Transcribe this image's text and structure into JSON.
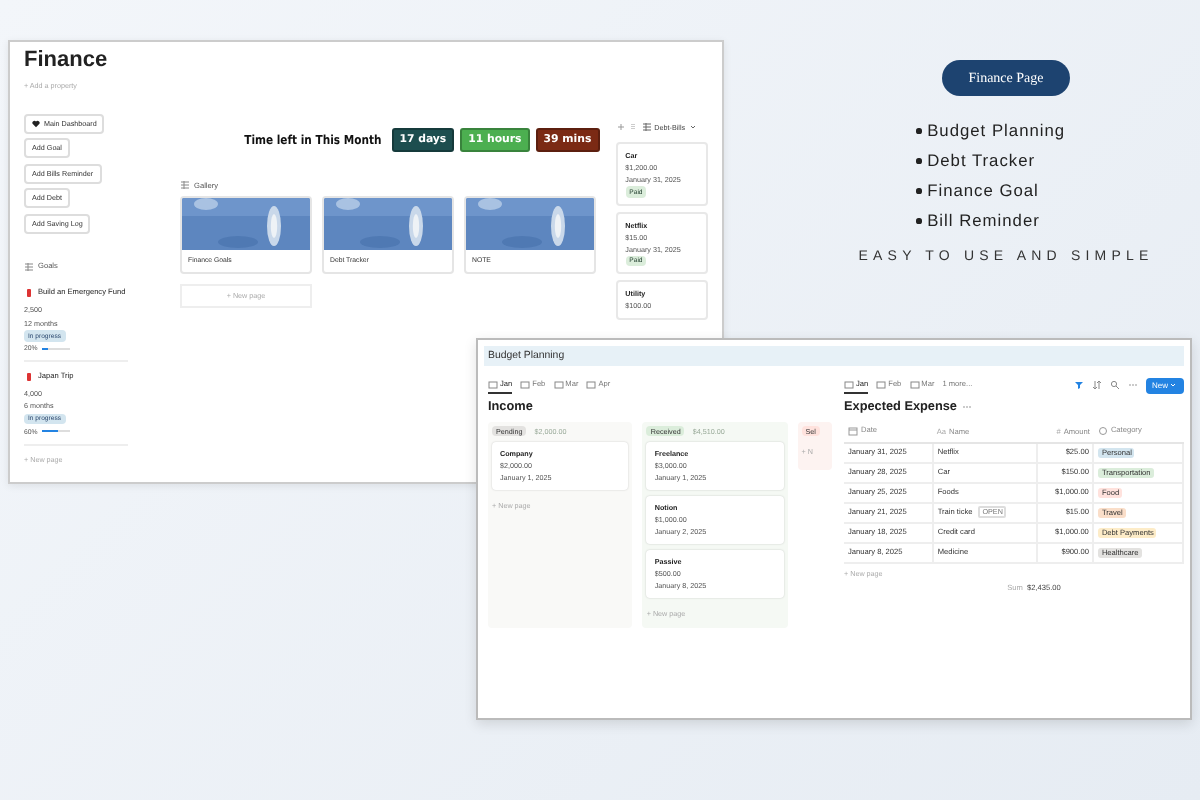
{
  "promo": {
    "badge": "Finance Page",
    "features": [
      "Budget Planning",
      "Debt Tracker",
      "Finance Goal",
      "Bill Reminder"
    ],
    "tagline": "EASY TO USE AND SIMPLE"
  },
  "finance_window": {
    "title": "Finance",
    "add_property": "+ Add a property",
    "quick_buttons": [
      {
        "label": "Main Dashboard",
        "kind": "heart"
      },
      {
        "label": "Add Goal"
      },
      {
        "label": "Add Bills Reminder"
      },
      {
        "label": "Add Debt"
      },
      {
        "label": "Add Saving Log"
      }
    ],
    "goals": {
      "title": "Goals",
      "new_page": "+ New page",
      "items": [
        {
          "name": "Build an Emergency Fund",
          "amount": "2,500",
          "duration": "12 months",
          "status": "In progress",
          "progress_label": "20%",
          "level": 0.2
        },
        {
          "name": "Japan Trip",
          "amount": "4,000",
          "duration": "6 months",
          "status": "In progress",
          "progress_label": "60%",
          "level": 0.6
        }
      ]
    },
    "countdown": {
      "label": "Time left in This Month",
      "units": [
        {
          "text": "17 days",
          "color": "#1d4e4f"
        },
        {
          "text": "11 hours",
          "color": "#4caf50"
        },
        {
          "text": "39 mins",
          "color": "#7b2a14"
        }
      ]
    },
    "gallery": {
      "title": "Gallery",
      "new_page": "+ New page",
      "cards": [
        {
          "title": "Finance Goals",
          "kind": "picture"
        },
        {
          "title": "Debt Tracker",
          "kind": "picture"
        },
        {
          "title": "NOTE",
          "kind": "picture"
        }
      ]
    },
    "bills": {
      "title": "Debt-Bills",
      "items": [
        {
          "name": "Car",
          "amount": "$1,200.00",
          "date": "January 31, 2025",
          "status": "Paid"
        },
        {
          "name": "Netflix",
          "amount": "$15.00",
          "date": "January 31, 2025",
          "status": "Paid"
        },
        {
          "name": "Utility",
          "amount": "$100.00"
        }
      ]
    }
  },
  "budget_window": {
    "title": "Budget Planning",
    "tabs": [
      {
        "label": "Jan",
        "selected": true
      },
      {
        "label": "Feb",
        "selected": false
      },
      {
        "label": "Mar",
        "selected": false
      },
      {
        "label": "Apr",
        "selected": false
      }
    ],
    "income": {
      "title": "Income",
      "columns": [
        {
          "status": "Pending",
          "color": "#e3e2e0",
          "total": "$2,000.00",
          "new_page": "+ New page",
          "cards": [
            {
              "name": "Company",
              "amount": "$2,000.00",
              "date": "January 1, 2025"
            }
          ]
        },
        {
          "status": "Received",
          "color": "#dbeddb",
          "total": "$4,510.00",
          "new_page": "+ New page",
          "cards": [
            {
              "name": "Freelance",
              "amount": "$3,000.00",
              "date": "January 1, 2025"
            },
            {
              "name": "Notion",
              "amount": "$1,000.00",
              "date": "January 2, 2025"
            },
            {
              "name": "Passive",
              "amount": "$500.00",
              "date": "January 8, 2025"
            }
          ]
        },
        {
          "status": "Sel",
          "color": "#ffe2dd",
          "new_page": "+ N"
        }
      ]
    },
    "expense": {
      "tabs": [
        {
          "label": "Jan",
          "selected": true
        },
        {
          "label": "Feb",
          "selected": false
        },
        {
          "label": "Mar",
          "selected": false
        }
      ],
      "more": "1 more...",
      "new_button": "New",
      "title": "Expected Expense",
      "columns": [
        {
          "label": "Date",
          "kind": "date"
        },
        {
          "label": "Name",
          "glyph": "Aa"
        },
        {
          "label": "Amount",
          "glyph": "#"
        },
        {
          "label": "Category",
          "kind": "select"
        }
      ],
      "rows": [
        {
          "date": "January 31, 2025",
          "name": "Netflix",
          "amount": "$25.00",
          "category": "Personal",
          "color": "#d3e5ef"
        },
        {
          "date": "January 28, 2025",
          "name": "Car",
          "amount": "$150.00",
          "category": "Transportation",
          "color": "#dbeddb"
        },
        {
          "date": "January 25, 2025",
          "name": "Foods",
          "amount": "$1,000.00",
          "category": "Food",
          "color": "#ffe2dd"
        },
        {
          "date": "January 21, 2025",
          "name": "Train ticke",
          "open": "OPEN",
          "amount": "$15.00",
          "category": "Travel",
          "color": "#fadec9"
        },
        {
          "date": "January 18, 2025",
          "name": "Credit card",
          "amount": "$1,000.00",
          "category": "Debt Payments",
          "color": "#fdecc8"
        },
        {
          "date": "January 8, 2025",
          "name": "Medicine",
          "amount": "$900.00",
          "category": "Healthcare",
          "color": "#e3e2e0"
        }
      ],
      "new_page": "+ New page",
      "sum_label": "Sum",
      "sum": "$2,435.00"
    }
  }
}
